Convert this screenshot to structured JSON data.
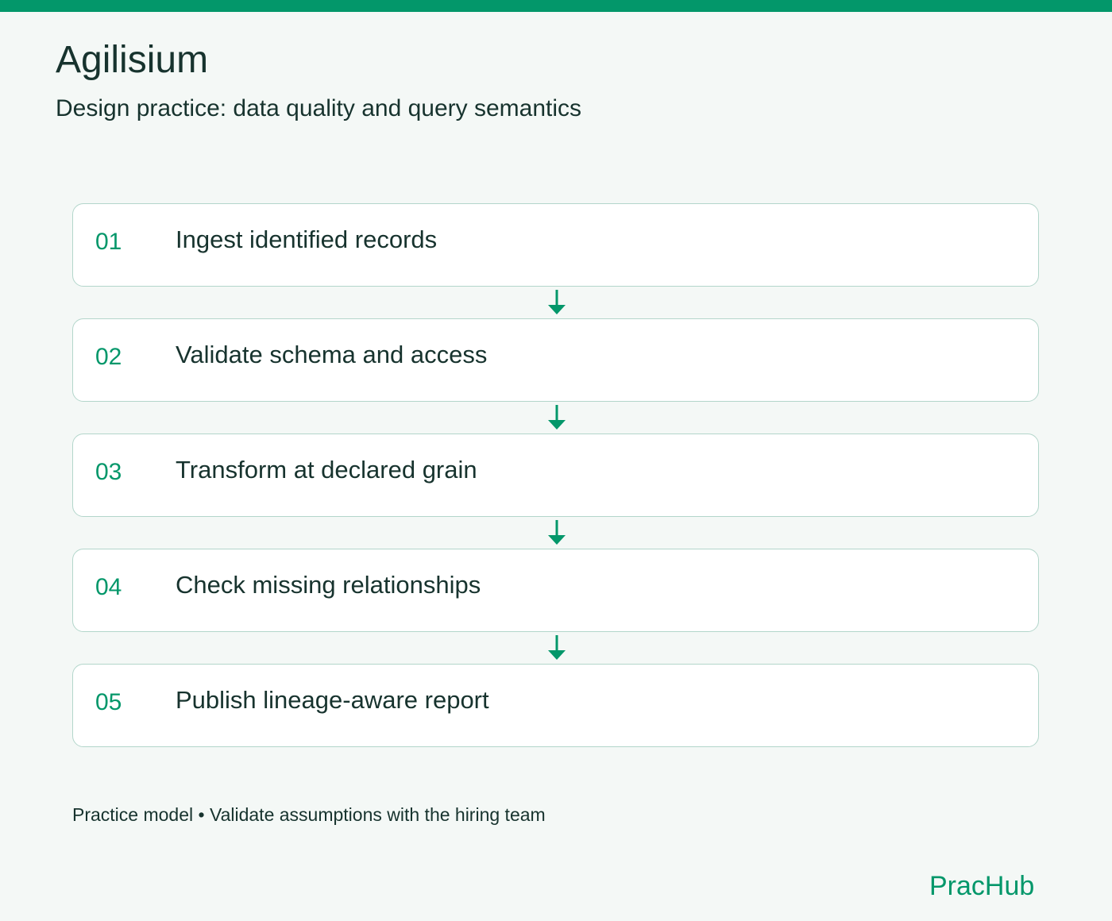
{
  "header": {
    "title": "Agilisium",
    "subtitle": "Design practice: data quality and query semantics"
  },
  "steps": [
    {
      "number": "01",
      "label": "Ingest identified records"
    },
    {
      "number": "02",
      "label": "Validate schema and access"
    },
    {
      "number": "03",
      "label": "Transform at declared grain"
    },
    {
      "number": "04",
      "label": "Check missing relationships"
    },
    {
      "number": "05",
      "label": "Publish lineage-aware report"
    }
  ],
  "footer": {
    "note": "Practice model • Validate assumptions with the hiring team",
    "brand": "PracHub"
  },
  "colors": {
    "accent": "#03976a",
    "text": "#17332e",
    "background": "#f4f8f6",
    "card_border": "#b3d6cb",
    "card_background": "#ffffff"
  },
  "icons": {
    "connector": "arrow-down-icon"
  }
}
